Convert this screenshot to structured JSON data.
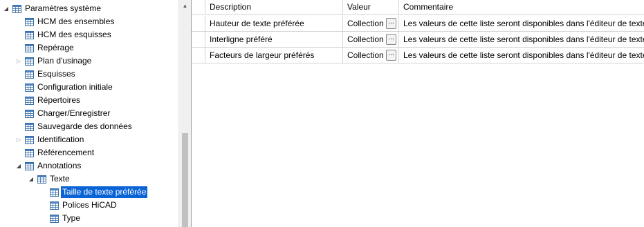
{
  "tree": {
    "items": [
      {
        "label": "Paramètres système",
        "level": 0,
        "expander": "expanded"
      },
      {
        "label": "HCM des ensembles",
        "level": 1,
        "expander": "none"
      },
      {
        "label": "HCM des esquisses",
        "level": 1,
        "expander": "none"
      },
      {
        "label": "Repérage",
        "level": 1,
        "expander": "none"
      },
      {
        "label": "Plan d'usinage",
        "level": 1,
        "expander": "collapsed"
      },
      {
        "label": "Esquisses",
        "level": 1,
        "expander": "none"
      },
      {
        "label": "Configuration initiale",
        "level": 1,
        "expander": "none"
      },
      {
        "label": "Répertoires",
        "level": 1,
        "expander": "none"
      },
      {
        "label": "Charger/Enregistrer",
        "level": 1,
        "expander": "none"
      },
      {
        "label": "Sauvegarde des données",
        "level": 1,
        "expander": "none"
      },
      {
        "label": "Identification",
        "level": 1,
        "expander": "collapsed"
      },
      {
        "label": "Référencement",
        "level": 1,
        "expander": "none"
      },
      {
        "label": "Annotations",
        "level": 1,
        "expander": "expanded"
      },
      {
        "label": "Texte",
        "level": 2,
        "expander": "expanded"
      },
      {
        "label": "Taille de texte préférée",
        "level": 3,
        "expander": "none",
        "selected": true
      },
      {
        "label": "Polices HiCAD",
        "level": 3,
        "expander": "none"
      },
      {
        "label": "Type",
        "level": 3,
        "expander": "none"
      }
    ]
  },
  "grid": {
    "columns": [
      "Description",
      "Valeur",
      "Commentaire"
    ],
    "rows": [
      {
        "description": "Hauteur de texte préférée",
        "value": "Collection",
        "button": "...",
        "comment": "Les valeurs de cette liste seront disponibles dans l'éditeur de texte."
      },
      {
        "description": "Interligne préféré",
        "value": "Collection",
        "button": "...",
        "comment": "Les valeurs de cette liste seront disponibles dans l'éditeur de texte."
      },
      {
        "description": "Facteurs de largeur préférés",
        "value": "Collection",
        "button": "...",
        "comment": "Les valeurs de cette liste seront disponibles dans l'éditeur de texte."
      }
    ]
  },
  "colors": {
    "selection": "#0a64d6",
    "icon_border": "#3a6ea5",
    "icon_header": "#4a7fc1"
  },
  "icons": {
    "tree_item": "table-icon",
    "expanded": "expanded-triangle-icon",
    "collapsed": "collapsed-triangle-icon"
  }
}
